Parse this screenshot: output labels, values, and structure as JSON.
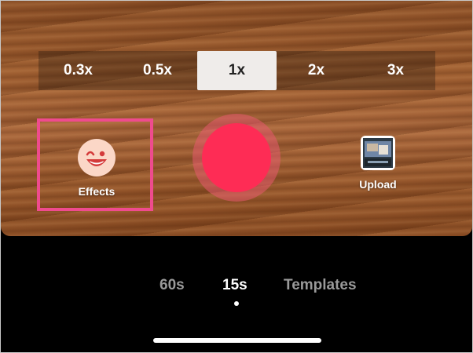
{
  "zoom": {
    "options": [
      "0.3x",
      "0.5x",
      "1x",
      "2x",
      "3x"
    ],
    "selected": "1x"
  },
  "effects": {
    "label": "Effects",
    "icon": "winking-face-icon"
  },
  "record": {
    "icon": "record-button"
  },
  "upload": {
    "label": "Upload",
    "icon": "gallery-thumbnail"
  },
  "modes": {
    "items": [
      "60s",
      "15s",
      "Templates"
    ],
    "active": "15s"
  },
  "colors": {
    "record": "#fe2c55",
    "highlight_border": "#ef4b8e",
    "background": "#000000"
  }
}
